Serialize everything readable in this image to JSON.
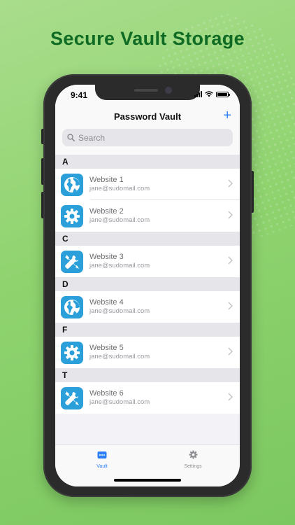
{
  "headline": "Secure Vault Storage",
  "status": {
    "time": "9:41"
  },
  "nav": {
    "title": "Password Vault",
    "add_label": "+"
  },
  "search": {
    "placeholder": "Search"
  },
  "sections": [
    {
      "letter": "A",
      "items": [
        {
          "title": "Website 1",
          "email": "jane@sudomail.com",
          "icon": "globe-icon"
        },
        {
          "title": "Website 2",
          "email": "jane@sudomail.com",
          "icon": "gear-icon"
        }
      ]
    },
    {
      "letter": "C",
      "items": [
        {
          "title": "Website 3",
          "email": "jane@sudomail.com",
          "icon": "tools-icon"
        }
      ]
    },
    {
      "letter": "D",
      "items": [
        {
          "title": "Website 4",
          "email": "jane@sudomail.com",
          "icon": "globe-icon"
        }
      ]
    },
    {
      "letter": "F",
      "items": [
        {
          "title": "Website 5",
          "email": "jane@sudomail.com",
          "icon": "gear-icon"
        }
      ]
    },
    {
      "letter": "T",
      "items": [
        {
          "title": "Website 6",
          "email": "jane@sudomail.com",
          "icon": "tools-icon"
        }
      ]
    }
  ],
  "tabs": {
    "vault": {
      "label": "Vault",
      "icon": "vault-icon",
      "active": true
    },
    "settings": {
      "label": "Settings",
      "icon": "gear-icon",
      "active": false
    }
  },
  "colors": {
    "accent": "#2d7ff9",
    "icon_bg": "#2a9fd9",
    "headline": "#0f6b24"
  }
}
